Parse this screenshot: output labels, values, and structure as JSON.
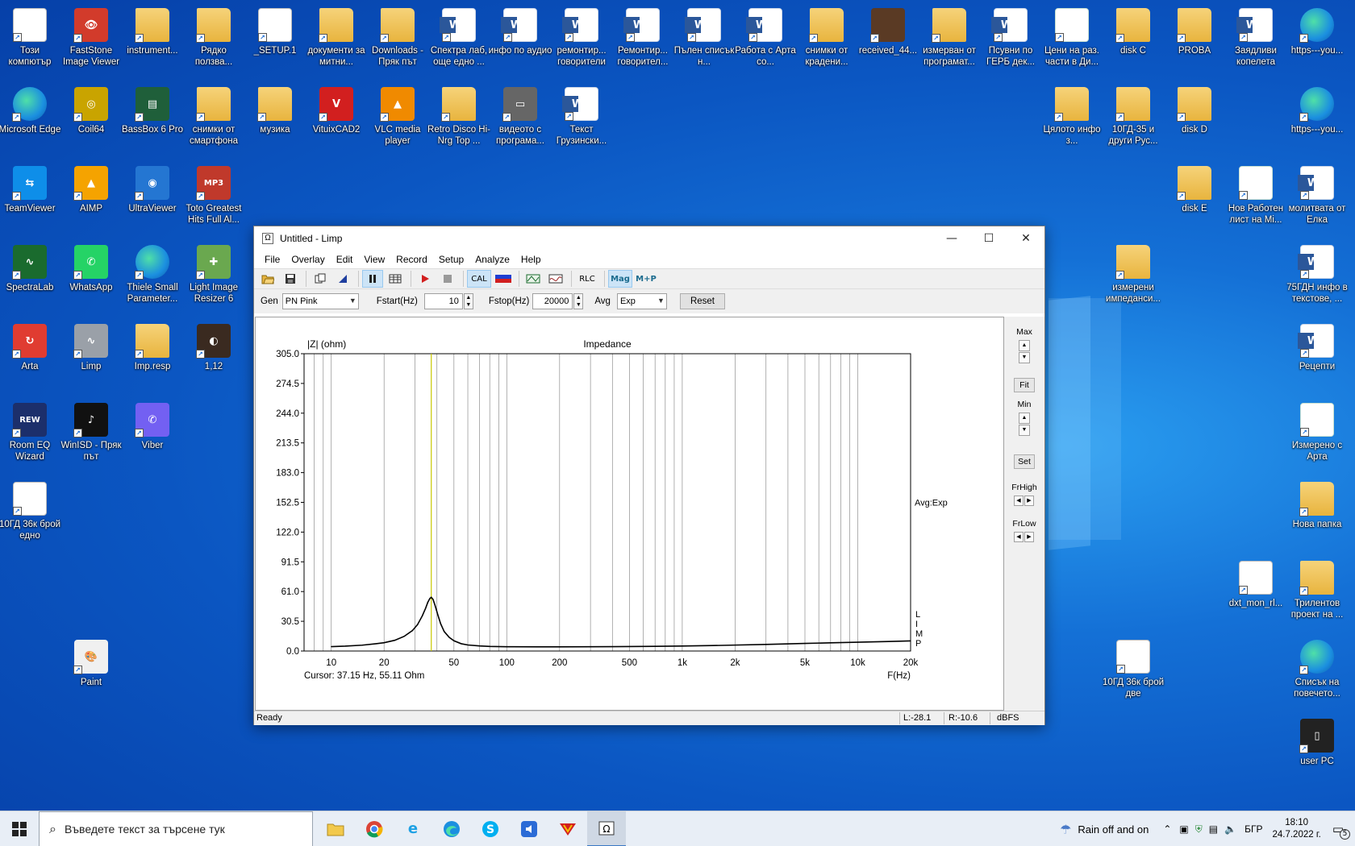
{
  "desktop": {
    "icons": [
      {
        "label": "Този компютър",
        "kind": "file",
        "glyph": "🖥"
      },
      {
        "label": "FastStone Image Viewer",
        "kind": "app",
        "glyph": "👁",
        "color": "#d23b2b"
      },
      {
        "label": "instrument...",
        "kind": "folder",
        "glyph": ""
      },
      {
        "label": "Рядко ползва...",
        "kind": "folder",
        "glyph": ""
      },
      {
        "label": "_SETUP.1",
        "kind": "file",
        "glyph": ""
      },
      {
        "label": "документи за митни...",
        "kind": "folder",
        "glyph": ""
      },
      {
        "label": "Downloads - Пряк път",
        "kind": "folder",
        "glyph": ""
      },
      {
        "label": "Спектра лаб, още едно ...",
        "kind": "word",
        "glyph": "W"
      },
      {
        "label": "инфо по аудио",
        "kind": "word",
        "glyph": "W"
      },
      {
        "label": "ремонтир... говорители",
        "kind": "word",
        "glyph": "W"
      },
      {
        "label": "Ремонтир... говорител...",
        "kind": "word",
        "glyph": "W"
      },
      {
        "label": "Пълен списък н...",
        "kind": "word",
        "glyph": "W"
      },
      {
        "label": "Работа с Арта со...",
        "kind": "word",
        "glyph": "W"
      },
      {
        "label": "снимки от крадени...",
        "kind": "folder",
        "glyph": ""
      },
      {
        "label": "received_44...",
        "kind": "app",
        "glyph": "",
        "color": "#5a3a24"
      },
      {
        "label": "измерван от програмат...",
        "kind": "folder",
        "glyph": ""
      },
      {
        "label": "Псувни по ГЕРБ дек...",
        "kind": "word",
        "glyph": "W"
      },
      {
        "label": "Цени на раз. части в Ди...",
        "kind": "excel",
        "glyph": "X"
      },
      {
        "label": "disk C",
        "kind": "folder",
        "glyph": ""
      },
      {
        "label": "PROBA",
        "kind": "folder",
        "glyph": ""
      },
      {
        "label": "Заядливи копелета",
        "kind": "word",
        "glyph": "W"
      },
      {
        "label": "https---you...",
        "kind": "edge",
        "glyph": ""
      },
      {
        "label": "Microsoft Edge",
        "kind": "edge",
        "glyph": ""
      },
      {
        "label": "Coil64",
        "kind": "app",
        "glyph": "◎",
        "color": "#c9a400"
      },
      {
        "label": "BassBox 6 Pro",
        "kind": "app",
        "glyph": "▤",
        "color": "#1f5f3a"
      },
      {
        "label": "снимки от смартфона",
        "kind": "folder",
        "glyph": ""
      },
      {
        "label": "музика",
        "kind": "folder",
        "glyph": ""
      },
      {
        "label": "VituixCAD2",
        "kind": "app",
        "glyph": "V",
        "color": "#d21f1f"
      },
      {
        "label": "VLC media player",
        "kind": "app",
        "glyph": "▲",
        "color": "#f08a00"
      },
      {
        "label": "Retro Disco Hi-Nrg Top ...",
        "kind": "folder",
        "glyph": ""
      },
      {
        "label": "видеото с програма...",
        "kind": "app",
        "glyph": "▭",
        "color": "#666"
      },
      {
        "label": "Текст Грузински...",
        "kind": "word",
        "glyph": "W"
      },
      {
        "label": "Цялото инфо з...",
        "kind": "folder",
        "glyph": ""
      },
      {
        "label": "10ГД-35 и други Рус...",
        "kind": "folder",
        "glyph": ""
      },
      {
        "label": "disk D",
        "kind": "folder",
        "glyph": ""
      },
      {
        "label": "https---you...",
        "kind": "edge",
        "glyph": ""
      },
      {
        "label": "TeamViewer",
        "kind": "app",
        "glyph": "⇆",
        "color": "#0e8ee9"
      },
      {
        "label": "AIMP",
        "kind": "app",
        "glyph": "▲",
        "color": "#f5a300"
      },
      {
        "label": "UltraViewer",
        "kind": "app",
        "glyph": "◉",
        "color": "#2476d2"
      },
      {
        "label": "Toto Greatest Hits Full Al...",
        "kind": "app",
        "glyph": "MP3",
        "color": "#c0392b"
      },
      {
        "label": "disk E",
        "kind": "folder",
        "glyph": ""
      },
      {
        "label": "Нов Работен лист на Mi...",
        "kind": "excel",
        "glyph": "X"
      },
      {
        "label": "молитвата от Елка",
        "kind": "word",
        "glyph": "W"
      },
      {
        "label": "SpectraLab",
        "kind": "app",
        "glyph": "∿",
        "color": "#1a6b2e"
      },
      {
        "label": "WhatsApp",
        "kind": "app",
        "glyph": "✆",
        "color": "#25d366"
      },
      {
        "label": "Thiele Small Parameter...",
        "kind": "edge",
        "glyph": ""
      },
      {
        "label": "Light Image Resizer 6",
        "kind": "app",
        "glyph": "✚",
        "color": "#6aa84f"
      },
      {
        "label": "измерени импеданси...",
        "kind": "folder",
        "glyph": ""
      },
      {
        "label": "75ГДН инфо в текстове, ...",
        "kind": "word",
        "glyph": "W"
      },
      {
        "label": "Arta",
        "kind": "app",
        "glyph": "↻",
        "color": "#e03c31"
      },
      {
        "label": "Limp",
        "kind": "app",
        "glyph": "∿",
        "color": "#9aa0a8"
      },
      {
        "label": "Imp.resp",
        "kind": "folder",
        "glyph": ""
      },
      {
        "label": "1,12",
        "kind": "app",
        "glyph": "◐",
        "color": "#3a2a20"
      },
      {
        "label": "Рецепти",
        "kind": "word",
        "glyph": "W"
      },
      {
        "label": "Room EQ Wizard",
        "kind": "app",
        "glyph": "REW",
        "color": "#1c2f6b"
      },
      {
        "label": "WinISD - Пряк път",
        "kind": "app",
        "glyph": "♪",
        "color": "#111"
      },
      {
        "label": "Viber",
        "kind": "app",
        "glyph": "✆",
        "color": "#7360f2"
      },
      {
        "label": "Измерено с Арта",
        "kind": "excel",
        "glyph": "X"
      },
      {
        "label": "10ГД 36к брой едно",
        "kind": "file",
        "glyph": "▭"
      },
      {
        "label": "Нова папка",
        "kind": "folder",
        "glyph": ""
      },
      {
        "label": "dxt_mon_rl...",
        "kind": "file",
        "glyph": "▭"
      },
      {
        "label": "Трилентов проект на ...",
        "kind": "folder",
        "glyph": ""
      },
      {
        "label": "Paint",
        "kind": "app",
        "glyph": "🎨",
        "color": "#f0f0f0"
      },
      {
        "label": "10ГД 36к брой две",
        "kind": "file",
        "glyph": "▭"
      },
      {
        "label": "Списък на повечето...",
        "kind": "edge",
        "glyph": ""
      },
      {
        "label": "user PC",
        "kind": "app",
        "glyph": "▯",
        "color": "#222"
      }
    ]
  },
  "window": {
    "title": "Untitled - Limp",
    "icon": "Ω",
    "controls": {
      "minimize": "—",
      "maximize": "☐",
      "close": "✕"
    },
    "menu": [
      "File",
      "Overlay",
      "Edit",
      "View",
      "Record",
      "Setup",
      "Analyze",
      "Help"
    ],
    "toolbar": {
      "cal": "CAL",
      "rlc": "RLC",
      "mag": "Mag",
      "mp": "M+P"
    },
    "gen": {
      "gen_label": "Gen",
      "gen_value": "PN Pink",
      "fstart_label": "Fstart(Hz)",
      "fstart_value": "10",
      "fstop_label": "Fstop(Hz)",
      "fstop_value": "20000",
      "avg_label": "Avg",
      "avg_value": "Exp",
      "reset_label": "Reset"
    },
    "right_panel": {
      "max": "Max",
      "fit": "Fit",
      "min": "Min",
      "set": "Set",
      "frhigh": "FrHigh",
      "frlow": "FrLow"
    },
    "status": {
      "ready": "Ready",
      "left": "L:-28.1",
      "right": "R:-10.6",
      "unit": "dBFS"
    }
  },
  "chart_data": {
    "type": "line",
    "title": "Impedance",
    "ylabel": "|Z| (ohm)",
    "xlabel": "F(Hz)",
    "x_scale": "log",
    "xlim": [
      7,
      20000
    ],
    "ylim": [
      0,
      305
    ],
    "y_ticks": [
      "305.0",
      "274.5",
      "244.0",
      "213.5",
      "183.0",
      "152.5",
      "122.0",
      "91.5",
      "61.0",
      "30.5",
      "0.0"
    ],
    "x_ticks": [
      {
        "f": 10,
        "label": "10"
      },
      {
        "f": 20,
        "label": "20"
      },
      {
        "f": 50,
        "label": "50"
      },
      {
        "f": 100,
        "label": "100"
      },
      {
        "f": 200,
        "label": "200"
      },
      {
        "f": 500,
        "label": "500"
      },
      {
        "f": 1000,
        "label": "1k"
      },
      {
        "f": 2000,
        "label": "2k"
      },
      {
        "f": 5000,
        "label": "5k"
      },
      {
        "f": 10000,
        "label": "10k"
      },
      {
        "f": 20000,
        "label": "20k"
      }
    ],
    "grid": true,
    "annotation_right": "Avg:Exp",
    "side_label": "LIMP",
    "cursor_text": "Cursor: 37.15 Hz, 55.11 Ohm",
    "cursor_freq": 37.15,
    "series": [
      {
        "color": "#000000",
        "x": [
          10,
          12,
          15,
          18,
          20,
          23,
          26,
          29,
          31,
          33,
          34.5,
          35.5,
          36.5,
          37.15,
          38,
          39,
          40.5,
          42,
          44,
          47,
          50,
          55,
          60,
          70,
          80,
          100,
          150,
          200,
          300,
          500,
          700,
          1000,
          1500,
          2000,
          3000,
          5000,
          7000,
          10000,
          15000,
          20000
        ],
        "y": [
          4.5,
          5.0,
          6.0,
          7.5,
          8.5,
          11,
          15,
          21,
          27,
          36,
          44,
          50,
          54,
          55.1,
          53,
          47,
          37,
          28,
          20,
          14,
          10.5,
          7.5,
          6.2,
          5.2,
          4.7,
          4.4,
          4.3,
          4.3,
          4.4,
          4.6,
          4.8,
          5.1,
          5.6,
          6.1,
          6.8,
          7.8,
          8.4,
          9.0,
          9.8,
          10.4
        ]
      }
    ]
  },
  "taskbar": {
    "search_placeholder": "Въведете текст за търсене тук",
    "weather": "Rain off and on",
    "lang": "БГР",
    "time": "18:10",
    "date": "24.7.2022 г.",
    "notif_count": "5"
  }
}
